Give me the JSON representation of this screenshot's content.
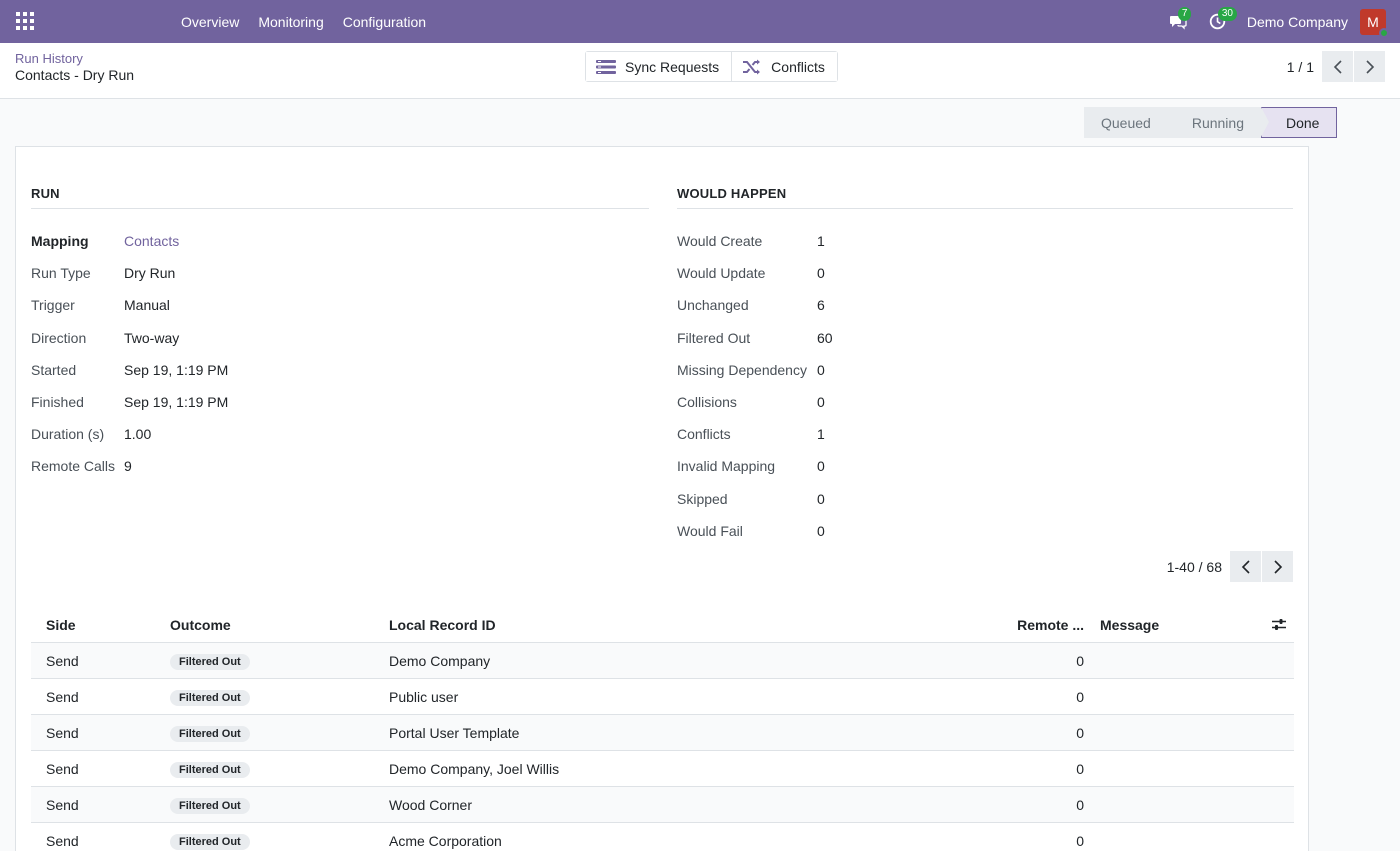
{
  "navbar": {
    "menu": [
      "Overview",
      "Monitoring",
      "Configuration"
    ],
    "chat_count": "7",
    "activity_count": "30",
    "company": "Demo Company",
    "avatar_letter": "M"
  },
  "breadcrumb": {
    "parent": "Run History",
    "current": "Contacts - Dry Run"
  },
  "smart_buttons": {
    "sync_requests": "Sync Requests",
    "conflicts": "Conflicts"
  },
  "record_pager": {
    "value": "1 / 1"
  },
  "statusbar": {
    "stages": [
      "Queued",
      "Running",
      "Done"
    ],
    "active": "Done"
  },
  "run": {
    "title": "RUN",
    "fields": [
      {
        "label": "Mapping",
        "value": "Contacts"
      },
      {
        "label": "Run Type",
        "value": "Dry Run"
      },
      {
        "label": "Trigger",
        "value": "Manual"
      },
      {
        "label": "Direction",
        "value": "Two-way"
      },
      {
        "label": "Started",
        "value": "Sep 19, 1:19 PM"
      },
      {
        "label": "Finished",
        "value": "Sep 19, 1:19 PM"
      },
      {
        "label": "Duration (s)",
        "value": "1.00"
      },
      {
        "label": "Remote Calls",
        "value": "9"
      }
    ]
  },
  "would_happen": {
    "title": "WOULD HAPPEN",
    "fields": [
      {
        "label": "Would Create",
        "value": "1"
      },
      {
        "label": "Would Update",
        "value": "0"
      },
      {
        "label": "Unchanged",
        "value": "6"
      },
      {
        "label": "Filtered Out",
        "value": "60"
      },
      {
        "label": "Missing Dependency",
        "value": "0"
      },
      {
        "label": "Collisions",
        "value": "0"
      },
      {
        "label": "Conflicts",
        "value": "1"
      },
      {
        "label": "Invalid Mapping",
        "value": "0"
      },
      {
        "label": "Skipped",
        "value": "0"
      },
      {
        "label": "Would Fail",
        "value": "0"
      }
    ]
  },
  "list_pager": {
    "value": "1-40 / 68"
  },
  "table": {
    "headers": {
      "side": "Side",
      "outcome": "Outcome",
      "local": "Local Record ID",
      "remote": "Remote ...",
      "message": "Message"
    },
    "rows": [
      {
        "side": "Send",
        "outcome": "Filtered Out",
        "local": "Demo Company",
        "remote": "0",
        "message": ""
      },
      {
        "side": "Send",
        "outcome": "Filtered Out",
        "local": "Public user",
        "remote": "0",
        "message": ""
      },
      {
        "side": "Send",
        "outcome": "Filtered Out",
        "local": "Portal User Template",
        "remote": "0",
        "message": ""
      },
      {
        "side": "Send",
        "outcome": "Filtered Out",
        "local": "Demo Company, Joel Willis",
        "remote": "0",
        "message": ""
      },
      {
        "side": "Send",
        "outcome": "Filtered Out",
        "local": "Wood Corner",
        "remote": "0",
        "message": ""
      },
      {
        "side": "Send",
        "outcome": "Filtered Out",
        "local": "Acme Corporation",
        "remote": "0",
        "message": ""
      }
    ]
  },
  "colors": {
    "brand": "#71639e",
    "badge": "#28a745"
  }
}
